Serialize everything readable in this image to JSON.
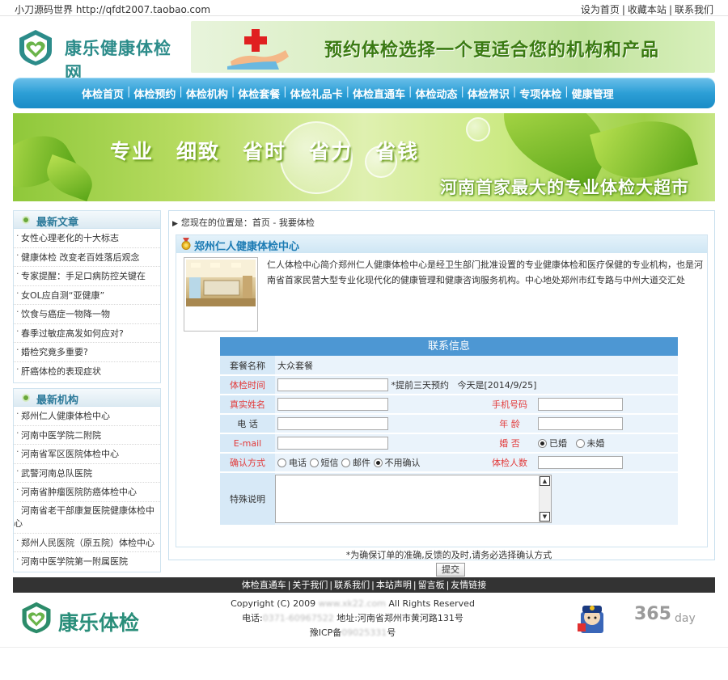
{
  "topbar": {
    "site_line": "小刀源码世界 http://qfdt2007.taobao.com",
    "links": [
      "设为首页",
      "收藏本站",
      "联系我们"
    ]
  },
  "header": {
    "logo_text": "康乐健康体检网",
    "slogan": "预约体检选择一个更适合您的机构和产品"
  },
  "nav": {
    "items": [
      "体检首页",
      "体检预约",
      "体检机构",
      "体检套餐",
      "体检礼品卡",
      "体检直通车",
      "体检动态",
      "体检常识",
      "专项体检",
      "健康管理"
    ]
  },
  "banner": {
    "words": [
      "专业",
      "细致",
      "省时",
      "省力",
      "省钱"
    ],
    "tagline": "河南首家最大的专业体检大超市"
  },
  "sidebar": {
    "articles_title": "最新文章",
    "articles": [
      "女性心理老化的十大标志",
      "健康体检 改变老百姓落后观念",
      "专家提醒：手足口病防控关键在",
      "女OL应自测“亚健康”",
      "饮食与癌症一物降一物",
      "春季过敏症高发如何应对?",
      "婚检究竟多重要?",
      "肝癌体检的表现症状"
    ],
    "orgs_title": "最新机构",
    "orgs": [
      "郑州仁人健康体检中心",
      "河南中医学院二附院",
      "河南省军区医院体检中心",
      "武警河南总队医院",
      "河南省肿瘤医院防癌体检中心",
      "河南省老干部康复医院健康体检中心",
      "郑州人民医院（原五院）体检中心",
      "河南中医学院第一附属医院"
    ]
  },
  "breadcrumb": {
    "prefix": "您现在的位置是：",
    "home": "首页",
    "current": " - 我要体检"
  },
  "org": {
    "name": "郑州仁人健康体检中心",
    "intro": "仁人体检中心简介郑州仁人健康体检中心是经卫生部门批准设置的专业健康体检和医疗保健的专业机构，也是河南省首家民营大型专业化现代化的健康管理和健康咨询服务机构。中心地处郑州市红专路与中州大道交汇处"
  },
  "form": {
    "title": "联系信息",
    "package_label": "套餐名称",
    "package_value": "大众套餐",
    "time_label": "体检时间",
    "time_value": "",
    "time_note": "*提前三天预约   今天是[2014/9/25]",
    "name_label": "真实姓名",
    "name_value": "",
    "mobile_label": "手机号码",
    "mobile_value": "",
    "phone_label": "电 话",
    "phone_value": "",
    "age_label": "年 龄",
    "age_value": "",
    "email_label": "E-mail",
    "email_value": "",
    "marital_label": "婚 否",
    "marital_options": [
      "已婚",
      "未婚"
    ],
    "marital_selected": "已婚",
    "confirm_label": "确认方式",
    "confirm_options": [
      "电话",
      "短信",
      "邮件",
      "不用确认"
    ],
    "confirm_selected": "不用确认",
    "count_label": "体检人数",
    "count_value": "",
    "special_label": "特殊说明",
    "special_value": "",
    "note": "*为确保订单的准确,反馈的及时,请务必选择确认方式",
    "submit_label": "提交"
  },
  "footer": {
    "links": [
      "体检直通车",
      "关于我们",
      "联系我们",
      "本站声明",
      "留言板",
      "友情链接"
    ],
    "logo_text": "康乐体检",
    "copyright_prefix": "Copyright (C) 2009 ",
    "copyright_site": "www.xk22.com",
    "copyright_suffix": " All Rights Reserved",
    "phone_prefix": "电话:",
    "phone_value": "0371-60967522",
    "address": " 地址:河南省郑州市黄河路131号",
    "icp_prefix": "豫ICP备",
    "icp_value": "09025331",
    "icp_suffix": "号",
    "badge_number": "365",
    "badge_text": "day"
  },
  "colors": {
    "nav_blue": "#2d9fd6",
    "form_header": "#4d97d3",
    "label_red": "#e23a3a",
    "logo_teal": "#2c8c8a",
    "footer_bar": "#333333"
  }
}
